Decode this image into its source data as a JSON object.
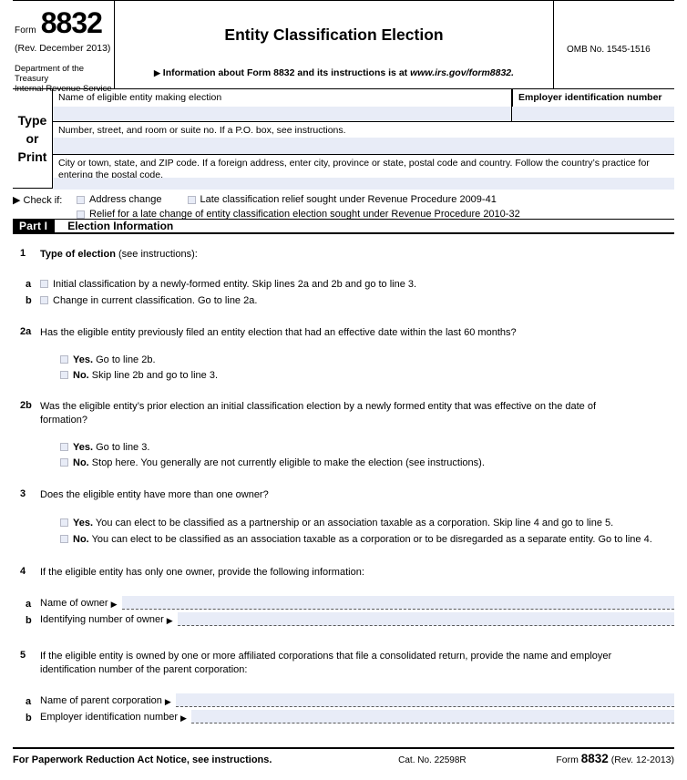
{
  "header": {
    "form_word": "Form",
    "form_number": "8832",
    "revision": "(Rev. December 2013)",
    "department_line1": "Department of the Treasury",
    "department_line2": "Internal Revenue Service",
    "title": "Entity Classification Election",
    "info_arrow": "▶",
    "info_text_pre": "Information about Form 8832 and its instructions is at ",
    "info_text_italic": "www.irs.gov/form8832.",
    "omb": "OMB No. 1545-1516"
  },
  "type_or_print": {
    "label_line1": "Type",
    "label_line2": "or",
    "label_line3": "Print",
    "name_caption": "Name of eligible entity making election",
    "ein_caption": "Employer identification number",
    "street_caption": "Number, street, and room or suite no. If a P.O. box, see instructions.",
    "city_caption": "City or town, state, and ZIP code. If a foreign address, enter city, province or state, postal code and country. Follow the country’s practice for entering the postal code."
  },
  "check_if": {
    "lead": "▶ Check if:",
    "option_address_change": "Address change",
    "option_late_classification": "Late classification relief sought under Revenue Procedure 2009-41",
    "option_relief_late_change": "Relief for a late change of entity classification election sought under Revenue Procedure 2010-32"
  },
  "part": {
    "tag": "Part I",
    "title": "Election Information"
  },
  "lines": {
    "line1": {
      "num": "1",
      "bold_text": "Type of election",
      "rest_text": "(see instructions):",
      "a_letter": "a",
      "a_text": "Initial classification by a newly-formed entity. Skip lines 2a and 2b and go to line 3.",
      "b_letter": "b",
      "b_text": "Change in current classification. Go to line 2a."
    },
    "line2a": {
      "num": "2a",
      "text": "Has the eligible entity previously filed an entity election that had an effective date within the last 60 months?",
      "yes_bold": "Yes.",
      "yes_text": "Go to line 2b.",
      "no_bold": "No.",
      "no_text": "Skip line 2b and go to line 3."
    },
    "line2b": {
      "num": "2b",
      "text": "Was the eligible entity’s prior election an initial classification election by a newly formed entity that was effective on the date of formation?",
      "yes_bold": "Yes.",
      "yes_text": "Go to line 3.",
      "no_bold": "No.",
      "no_text": "Stop here. You generally are not currently eligible to make the election (see instructions)."
    },
    "line3": {
      "num": "3",
      "text": "Does the eligible entity have more than one owner?",
      "yes_bold": "Yes.",
      "yes_text": "You can elect to be classified as a partnership or an association taxable as a corporation. Skip line 4 and go to line 5.",
      "no_bold": "No.",
      "no_text": "You can elect to be classified as an association taxable as a corporation or to be disregarded as a separate entity. Go to  line 4."
    },
    "line4": {
      "num": "4",
      "text": "If the eligible entity has only one owner, provide the following information:",
      "a_letter": "a",
      "a_label": "Name of owner",
      "b_letter": "b",
      "b_label": "Identifying number of owner"
    },
    "line5": {
      "num": "5",
      "text": "If the eligible entity is owned by one or more affiliated corporations that file a consolidated return, provide the name and employer identification number of the parent corporation:",
      "a_letter": "a",
      "a_label": "Name of parent corporation",
      "b_letter": "b",
      "b_label": "Employer identification number"
    }
  },
  "footer": {
    "notice": "For Paperwork Reduction Act Notice, see instructions.",
    "cat_no": "Cat. No. 22598R",
    "form_word": "Form",
    "form_number": "8832",
    "rev": "(Rev. 12-2013)"
  },
  "symbols": {
    "arrow": "▶"
  }
}
